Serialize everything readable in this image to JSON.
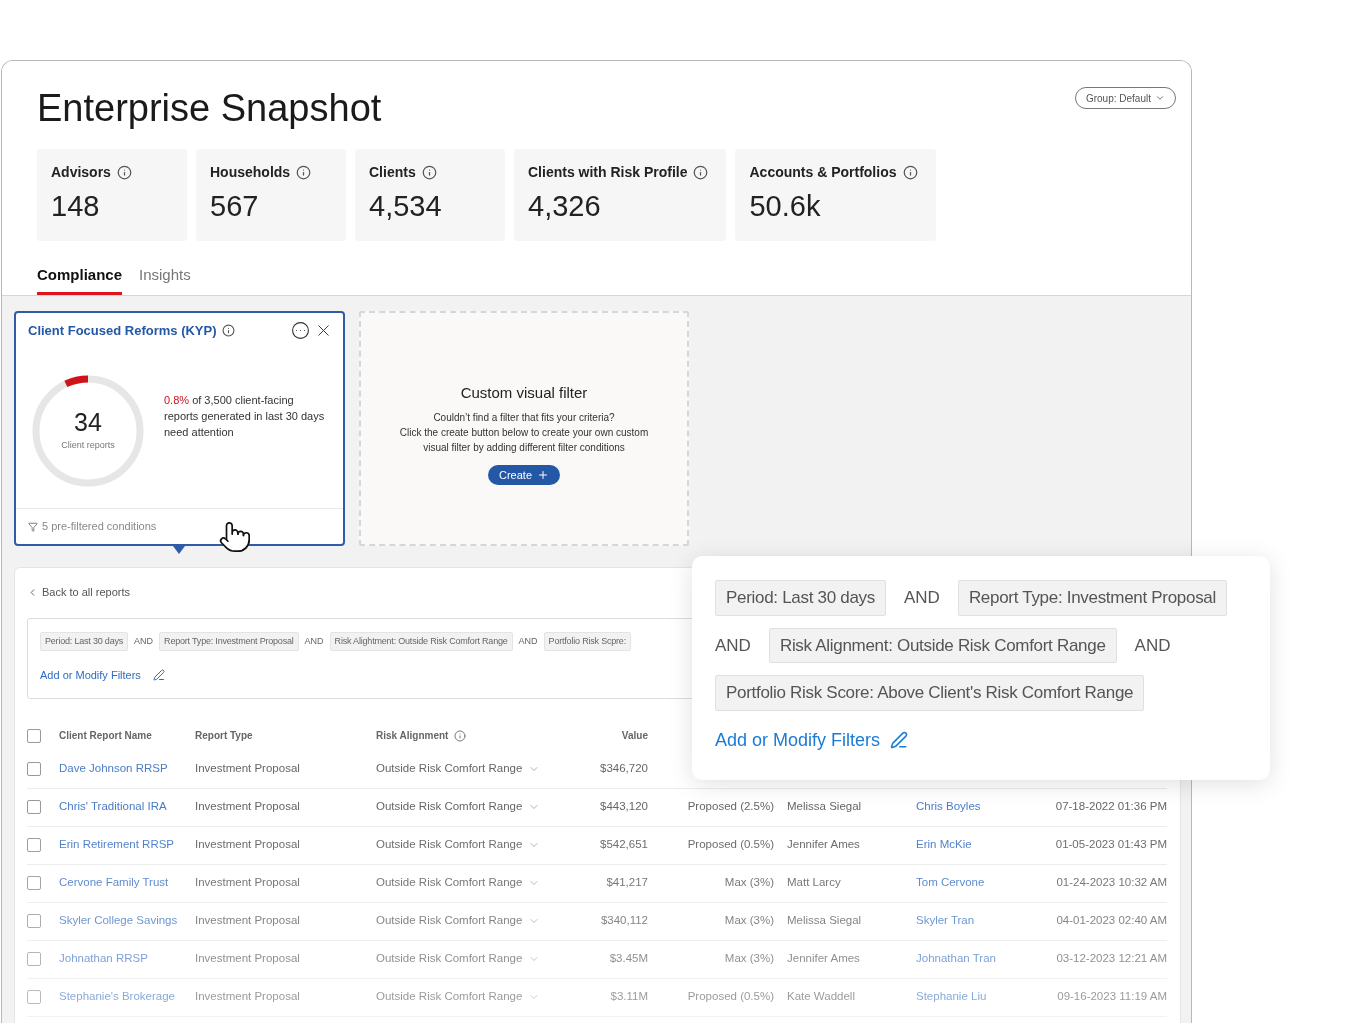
{
  "header": {
    "title": "Enterprise Snapshot",
    "group_button": "Group: Default"
  },
  "stats": [
    {
      "label": "Advisors",
      "value": "148"
    },
    {
      "label": "Households",
      "value": "567"
    },
    {
      "label": "Clients",
      "value": "4,534"
    },
    {
      "label": "Clients with Risk Profile",
      "value": "4,326"
    },
    {
      "label": "Accounts & Portfolios",
      "value": "50.6k"
    }
  ],
  "tabs": [
    {
      "label": "Compliance",
      "selected": true
    },
    {
      "label": "Insights",
      "selected": false
    }
  ],
  "kyp_card": {
    "title": "Client Focused Reforms (KYP)",
    "count": "34",
    "count_label": "Client reports",
    "level": 0.07,
    "highlight": "0.8%",
    "summary": " of 3,500 client-facing reports generated in last 30 days need attention",
    "footer": "5 pre-filtered conditions"
  },
  "custom_filter": {
    "title": "Custom visual filter",
    "description_lines": [
      "Couldn’t find a filter that fits your criteria?",
      "Click the create button below to create your own custom",
      "visual filter by adding different filter conditions"
    ],
    "button": "Create"
  },
  "report": {
    "back_link": "Back to all reports",
    "filters": [
      {
        "kind": "chip",
        "text": "Period: Last 30 days"
      },
      {
        "kind": "operator",
        "text": "AND"
      },
      {
        "kind": "chip",
        "text": "Report Type: Investment Proposal"
      },
      {
        "kind": "operator",
        "text": "AND"
      },
      {
        "kind": "chip",
        "text": "Risk Alightment: Outside Risk Comfort Range"
      },
      {
        "kind": "operator",
        "text": "AND"
      },
      {
        "kind": "chip",
        "text": "Portfolio Risk Scpre:"
      }
    ],
    "add_filters": "Add or Modify Filters",
    "all_checked": false,
    "columns": [
      "Client Report Name",
      "Report Type",
      "Risk Alignment",
      "Value"
    ],
    "rows": [
      {
        "checked": false,
        "name": "Dave Johnson RRSP",
        "type": "Investment Proposal",
        "risk": "Outside Risk Comfort Range",
        "value": "$346,720"
      },
      {
        "checked": false,
        "name": "Chris' Traditional IRA",
        "type": "Investment Proposal",
        "risk": "Outside Risk Comfort Range",
        "value": "$443,120",
        "column_5": "Proposed (2.5%)",
        "column_6": "Melissa Siegal",
        "column_7": "Chris Boyles",
        "column_8": "07-18-2022 01:36 PM"
      },
      {
        "checked": false,
        "name": "Erin Retirement RRSP",
        "type": "Investment Proposal",
        "risk": "Outside Risk Comfort Range",
        "value": "$542,651",
        "column_5": "Proposed (0.5%)",
        "column_6": "Jennifer Ames",
        "column_7": "Erin McKie",
        "column_8": "01-05-2023 01:43 PM"
      },
      {
        "checked": false,
        "name": "Cervone Family Trust",
        "type": "Investment Proposal",
        "risk": "Outside Risk Comfort Range",
        "value": "$41,217",
        "column_5": "Max (3%)",
        "column_6": "Matt Larcy",
        "column_7": "Tom Cervone",
        "column_8": "01-24-2023 10:32 AM"
      },
      {
        "checked": false,
        "name": "Skyler College Savings",
        "type": "Investment Proposal",
        "risk": "Outside Risk Comfort Range",
        "value": "$340,112",
        "column_5": "Max (3%)",
        "column_6": "Melissa Siegal",
        "column_7": "Skyler Tran",
        "column_8": "04-01-2023 02:40 AM"
      },
      {
        "checked": false,
        "name": "Johnathan RRSP",
        "type": "Investment Proposal",
        "risk": "Outside Risk Comfort Range",
        "value": "$3.45M",
        "column_5": "Max (3%)",
        "column_6": "Jennifer Ames",
        "column_7": "Johnathan Tran",
        "column_8": "03-12-2023 12:21 AM"
      },
      {
        "checked": false,
        "name": "Stephanie's Brokerage",
        "type": "Investment Proposal",
        "risk": "Outside Risk Comfort Range",
        "value": "$3.11M",
        "column_5": "Proposed (0.5%)",
        "column_6": "Kate Waddell",
        "column_7": "Stephanie Liu",
        "column_8": "09-16-2023 11:19 AM"
      }
    ]
  },
  "popover": {
    "filters": [
      {
        "kind": "chip",
        "text": "Period: Last 30 days"
      },
      {
        "kind": "operator",
        "text": "AND"
      },
      {
        "kind": "chip",
        "text": "Report Type: Investment Proposal"
      },
      {
        "kind": "operator",
        "text": "AND"
      },
      {
        "kind": "chip",
        "text": "Risk Alignment: Outside Risk Comfort Range"
      },
      {
        "kind": "operator",
        "text": "AND"
      },
      {
        "kind": "chip",
        "text": "Portfolio Risk Score: Above Client's Risk Comfort Range"
      }
    ],
    "add_filters": "Add or Modify Filters"
  }
}
